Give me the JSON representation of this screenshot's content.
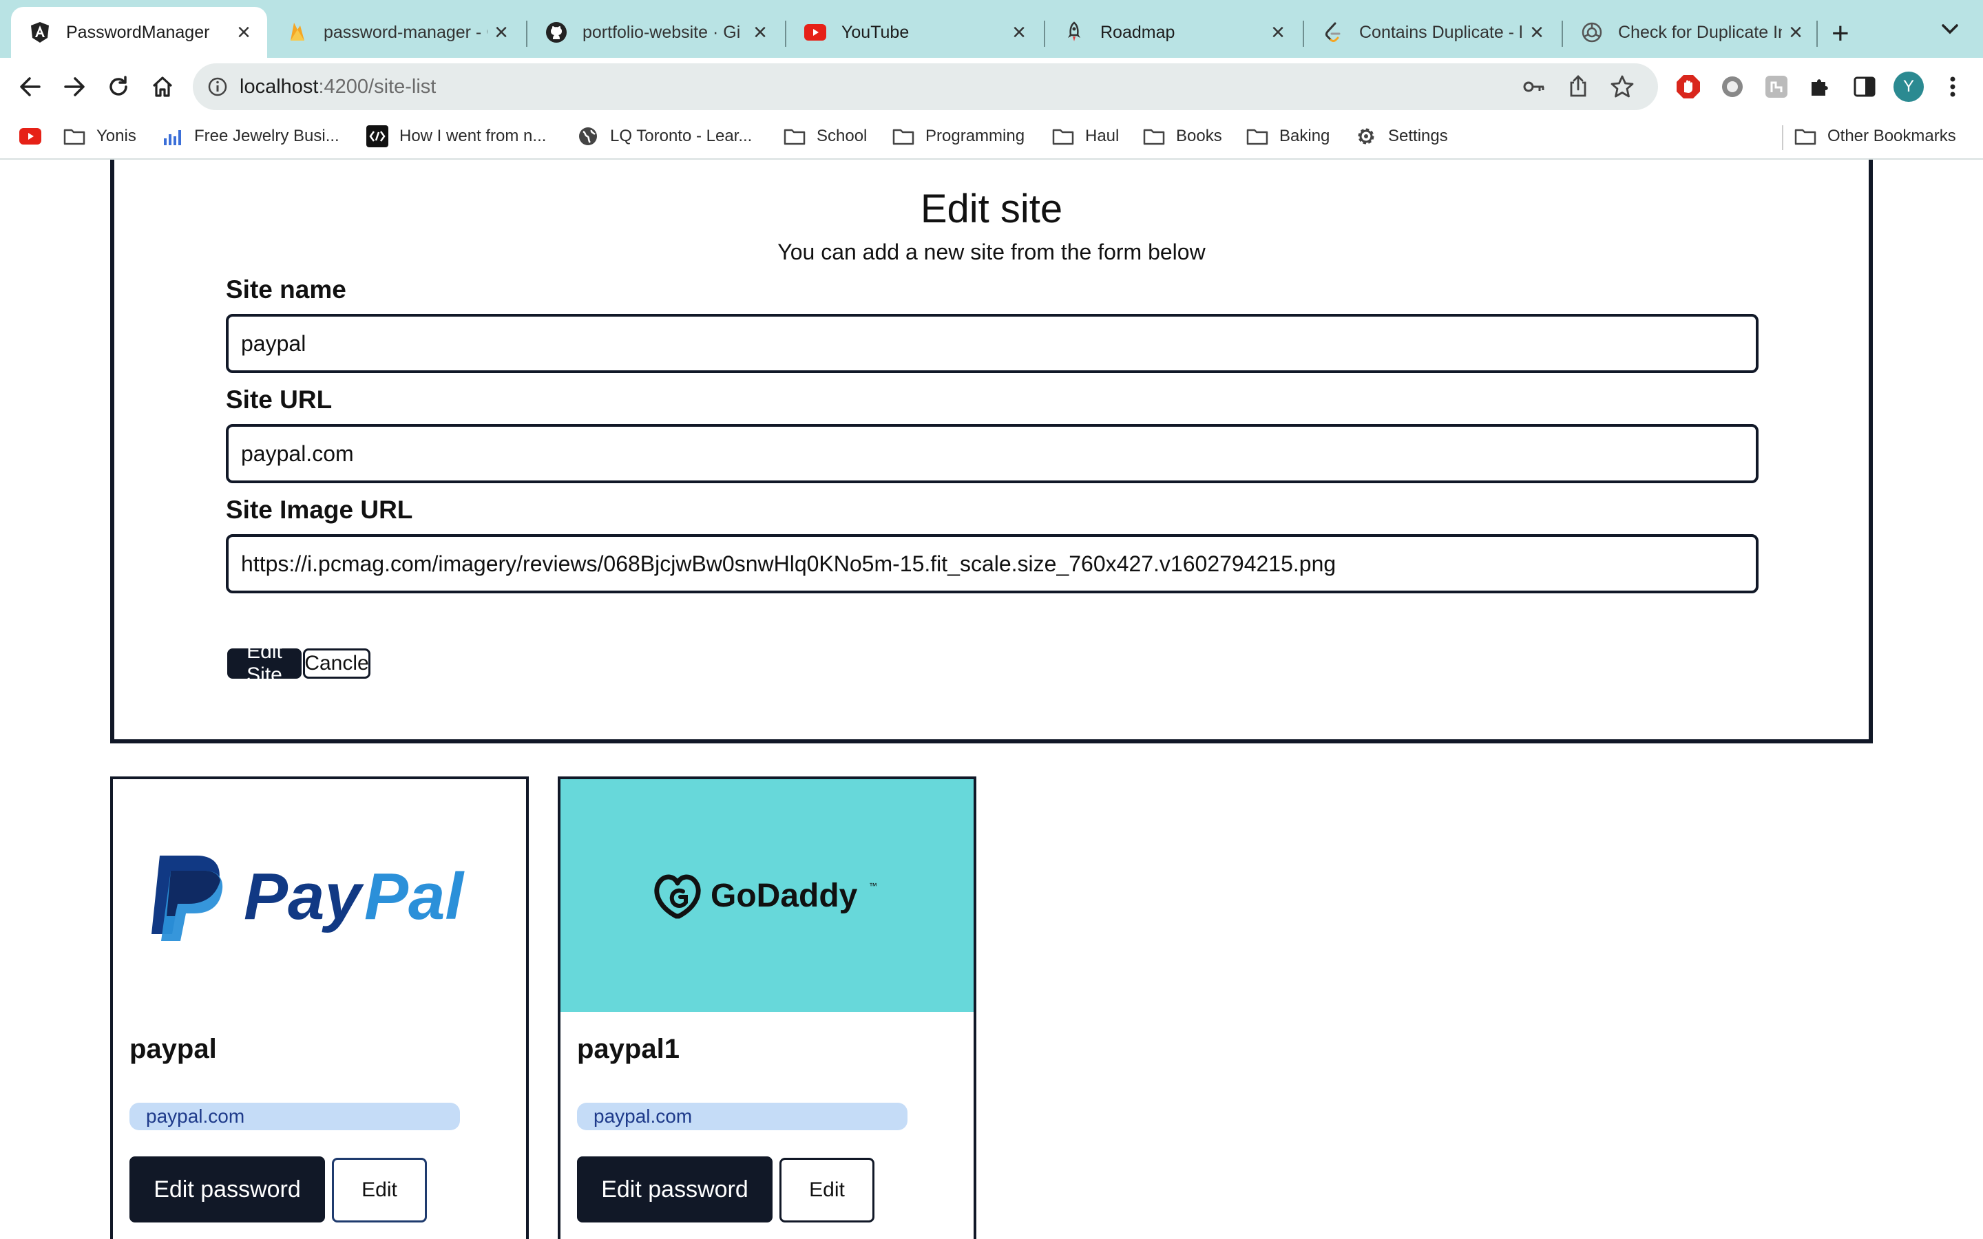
{
  "browser": {
    "tabs": [
      {
        "title": "PasswordManager",
        "icon": "angular-icon",
        "active": true
      },
      {
        "title": "password-manager - Gi",
        "icon": "firebase-icon",
        "active": false
      },
      {
        "title": "portfolio-website · Gi",
        "icon": "github-icon",
        "active": false
      },
      {
        "title": "YouTube",
        "icon": "youtube-icon",
        "active": false
      },
      {
        "title": "Roadmap",
        "icon": "rocket-icon",
        "active": false
      },
      {
        "title": "Contains Duplicate - l",
        "icon": "leetcode-icon",
        "active": false
      },
      {
        "title": "Check for Duplicate In",
        "icon": "openai-icon",
        "active": false
      }
    ],
    "url_host": "localhost",
    "url_rest": ":4200/site-list",
    "profile_initial": "Y",
    "bookmarks": [
      {
        "label": "",
        "icon": "youtube-icon"
      },
      {
        "label": "Yonis",
        "icon": "folder-icon"
      },
      {
        "label": "Free Jewelry Busi...",
        "icon": "chart-icon"
      },
      {
        "label": "How I went from n...",
        "icon": "brackets-icon"
      },
      {
        "label": "LQ Toronto - Lear...",
        "icon": "globe-icon"
      },
      {
        "label": "School",
        "icon": "folder-icon"
      },
      {
        "label": "Programming",
        "icon": "folder-icon"
      },
      {
        "label": "Haul",
        "icon": "folder-icon"
      },
      {
        "label": "Books",
        "icon": "folder-icon"
      },
      {
        "label": "Baking",
        "icon": "folder-icon"
      },
      {
        "label": "Settings",
        "icon": "gear-icon"
      }
    ],
    "other_bookmarks": "Other Bookmarks"
  },
  "form": {
    "title": "Edit site",
    "subtitle": "You can add a new site from the form below",
    "site_name_label": "Site name",
    "site_name_value": "paypal",
    "site_url_label": "Site URL",
    "site_url_value": "paypal.com",
    "site_image_label": "Site Image URL",
    "site_image_value": "https://i.pcmag.com/imagery/reviews/068BjcjwBw0snwHlq0KNo5m-15.fit_scale.size_760x427.v1602794215.png",
    "submit_label": "Edit Site",
    "cancel_label": "Cancle"
  },
  "cards": [
    {
      "title": "paypal",
      "url": "paypal.com",
      "logo_a": "Pay",
      "logo_b": "Pal",
      "edit_password_label": "Edit password",
      "edit_label": "Edit"
    },
    {
      "title": "paypal1",
      "url": "paypal.com",
      "logo": "GoDaddy",
      "logo_mark": "™",
      "edit_password_label": "Edit password",
      "edit_label": "Edit"
    }
  ],
  "colors": {
    "tabstrip": "#b9e3e4",
    "dark": "#111827",
    "url_badge": "#c5dcf7",
    "godaddy_bg": "#67d8da",
    "paypal_dark": "#113984",
    "paypal_light": "#2b90d9"
  }
}
